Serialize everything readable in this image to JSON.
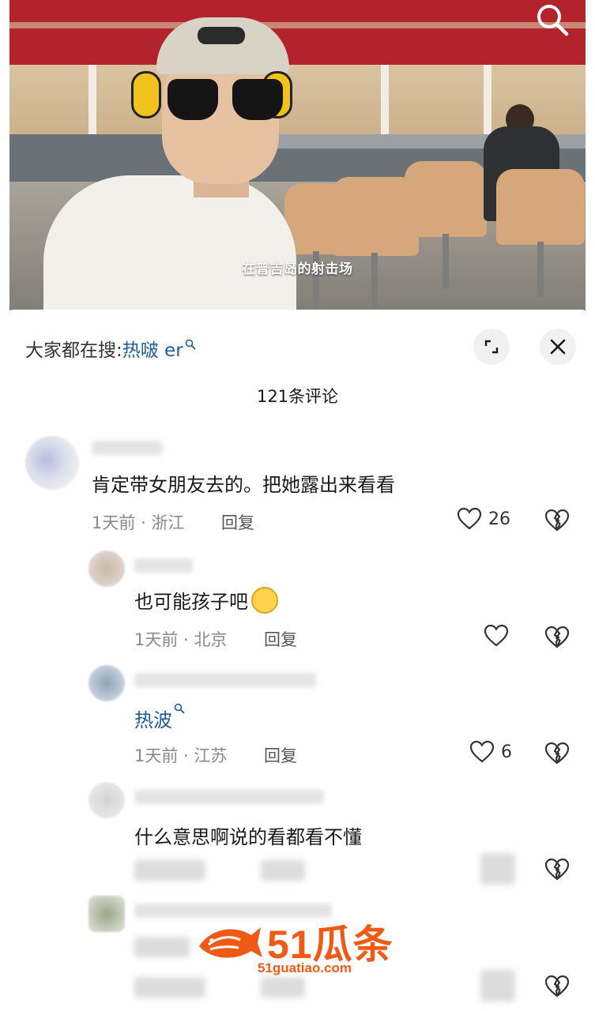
{
  "video": {
    "caption": "在普吉岛的射击场"
  },
  "sheet": {
    "trending_prefix": "大家都在搜:",
    "trending_keyword": "热啵 er",
    "comment_count_title": "121条评论"
  },
  "comments": [
    {
      "text": "肯定带女朋友去的。把她露出来看看",
      "time_location": "1天前 · 浙江",
      "reply_label": "回复",
      "likes": "26"
    },
    {
      "text": "也可能孩子吧",
      "time_location": "1天前 · 北京",
      "reply_label": "回复",
      "likes": ""
    },
    {
      "keyword_link": "热波",
      "time_location": "1天前 · 江苏",
      "reply_label": "回复",
      "likes": "6"
    },
    {
      "text": "什么意思啊说的看都看不懂"
    }
  ],
  "watermark": {
    "brand": "51瓜条",
    "url": "51guatiao.com"
  },
  "icons": {
    "search": "search-icon",
    "expand": "expand-icon",
    "close": "close-icon",
    "like": "heart-outline-icon",
    "dislike": "broken-heart-icon"
  },
  "colors": {
    "link_blue": "#1d5d93",
    "meta_gray": "#8a8a8a",
    "watermark_orange": "#f05a14"
  }
}
